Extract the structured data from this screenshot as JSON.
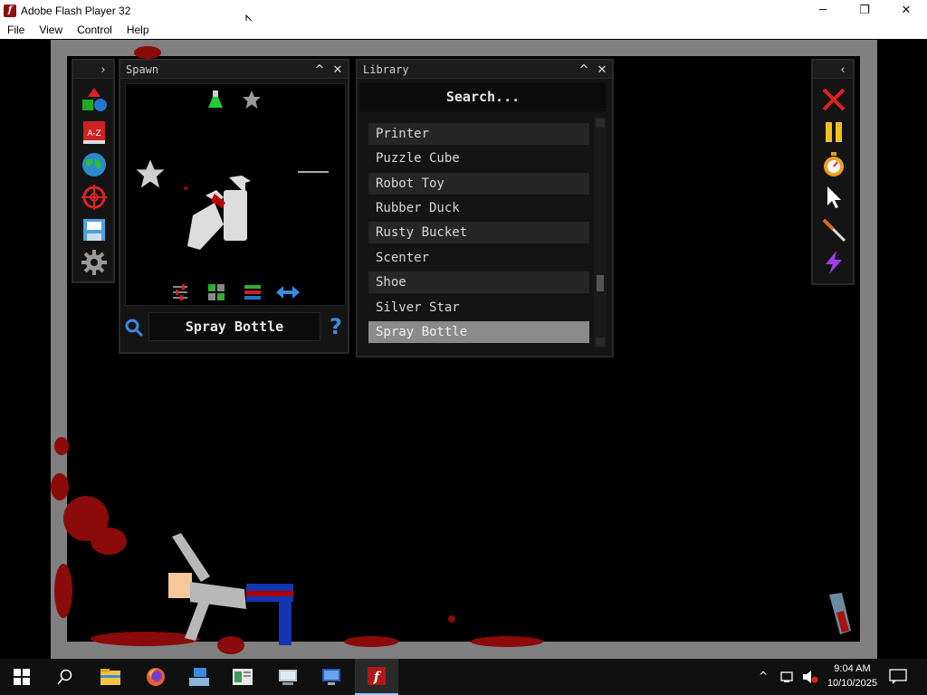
{
  "window": {
    "title": "Adobe Flash Player 32",
    "controls": {
      "minimize": "─",
      "maximize": "❐",
      "close": "✕"
    }
  },
  "menu": {
    "items": [
      "File",
      "View",
      "Control",
      "Help"
    ]
  },
  "spawn_panel": {
    "title": "Spawn",
    "selected_item": "Spray Bottle",
    "help_label": "?"
  },
  "library_panel": {
    "title": "Library",
    "search_placeholder": "Search...",
    "items": [
      {
        "label": "Printer",
        "selected": false
      },
      {
        "label": "Puzzle Cube",
        "selected": false
      },
      {
        "label": "Robot Toy",
        "selected": false
      },
      {
        "label": "Rubber Duck",
        "selected": false
      },
      {
        "label": "Rusty Bucket",
        "selected": false
      },
      {
        "label": "Scenter",
        "selected": false
      },
      {
        "label": "Shoe",
        "selected": false
      },
      {
        "label": "Silver Star",
        "selected": false
      },
      {
        "label": "Spray Bottle",
        "selected": true
      }
    ]
  },
  "header_buttons": {
    "expand": "›",
    "collapse": "‹",
    "minimize": "^",
    "close": "✕"
  },
  "left_tools": [
    "shapes-icon",
    "a-z-icon",
    "globe-icon",
    "target-icon",
    "save-icon",
    "gear-icon"
  ],
  "right_tools": [
    "clear-icon",
    "pause-icon",
    "stopwatch-icon",
    "cursor-icon",
    "knife-icon",
    "lightning-icon"
  ],
  "taskbar": {
    "time": "9:04 AM",
    "date": "10/10/2025"
  },
  "colors": {
    "panel_bg": "#141414",
    "selected_item": "#8a8a8a",
    "blood": "#8b0a0a",
    "frame": "#808080"
  }
}
